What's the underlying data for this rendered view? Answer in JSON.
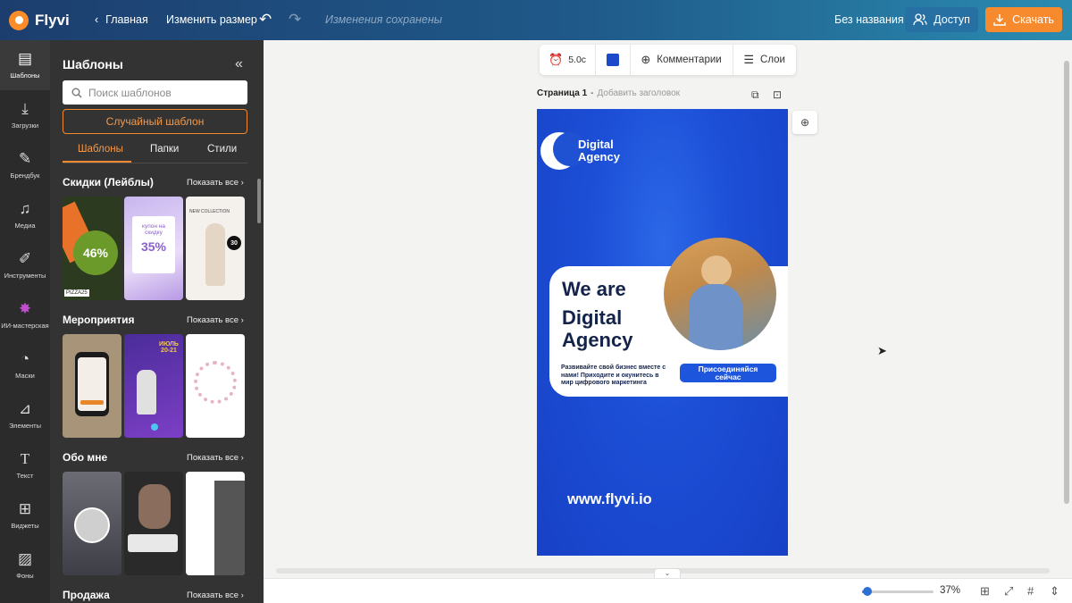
{
  "app": {
    "name": "Flyvi"
  },
  "topbar": {
    "home_label": "Главная",
    "resize_label": "Изменить размер",
    "saved_status": "Изменения сохранены",
    "doc_name": "Без названия",
    "access_label": "Доступ",
    "download_label": "Скачать"
  },
  "rail": {
    "items": [
      {
        "label": "Шаблоны",
        "icon": "templates-icon"
      },
      {
        "label": "Загрузки",
        "icon": "upload-icon"
      },
      {
        "label": "Брендбук",
        "icon": "brandbook-icon"
      },
      {
        "label": "Медиа",
        "icon": "media-icon"
      },
      {
        "label": "Инструменты",
        "icon": "tools-icon"
      },
      {
        "label": "ИИ-мастерская",
        "icon": "ai-workshop-icon"
      },
      {
        "label": "Маски",
        "icon": "masks-icon"
      },
      {
        "label": "Элементы",
        "icon": "elements-icon"
      },
      {
        "label": "Текст",
        "icon": "text-icon"
      },
      {
        "label": "Виджеты",
        "icon": "widgets-icon"
      },
      {
        "label": "Фоны",
        "icon": "backgrounds-icon"
      }
    ]
  },
  "panel": {
    "title": "Шаблоны",
    "search_placeholder": "Поиск шаблонов",
    "random_label": "Случайный шаблон",
    "tabs": [
      "Шаблоны",
      "Папки",
      "Стили"
    ],
    "show_all": "Показать все",
    "sections": [
      {
        "title": "Скидки (Лейблы)",
        "thumbs": [
          {
            "big": "46%",
            "small": "PIZZA25"
          },
          {
            "big": "35%",
            "small": "купон на скидку"
          },
          {
            "big": "30",
            "small": "NEW COLLECTION"
          }
        ]
      },
      {
        "title": "Мероприятия",
        "thumbs": [
          {
            "big": "",
            "small": ""
          },
          {
            "big": "ИЮЛЬ 20-21",
            "small": ""
          },
          {
            "big": "",
            "small": ""
          }
        ]
      },
      {
        "title": "Обо мне",
        "thumbs": [
          {
            "big": "",
            "small": ""
          },
          {
            "big": "",
            "small": ""
          },
          {
            "big": "",
            "small": ""
          }
        ]
      },
      {
        "title": "Продажа",
        "thumbs": []
      }
    ]
  },
  "canvas_toolbar": {
    "duration": "5.0с",
    "color": "#1b49c9",
    "comments_label": "Комментарии",
    "layers_label": "Слои"
  },
  "page": {
    "label": "Страница 1",
    "separator": "-",
    "add_title": "Добавить заголовок"
  },
  "design": {
    "logo_line1": "Digital",
    "logo_line2": "Agency",
    "headline1": "We are",
    "headline2": "Digital",
    "headline3": "Agency",
    "body": "Развивайте свой бизнес вместе с нами! Приходите и окунитесь в мир цифрового маркетинга",
    "cta": "Присоединяйся сейчас",
    "url": "www.flyvi.io"
  },
  "bottombar": {
    "zoom": "37%",
    "zoom_level": 0.08
  },
  "colors": {
    "accent": "#f78a2d",
    "brand_blue": "#1b49c9"
  }
}
